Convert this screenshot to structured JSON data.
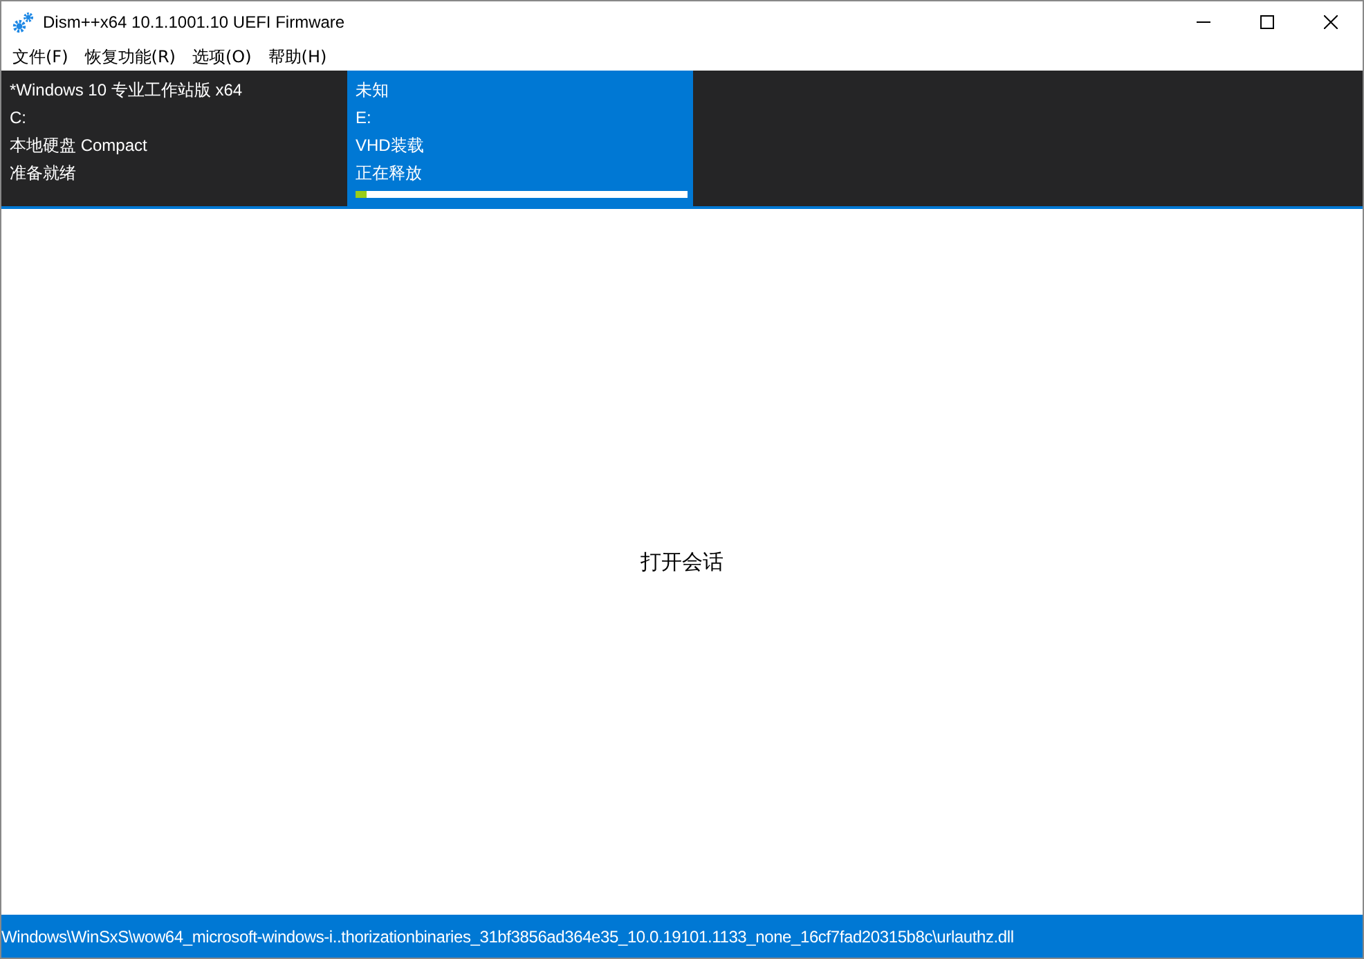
{
  "window": {
    "title": "Dism++x64 10.1.1001.10 UEFI Firmware"
  },
  "menu": [
    "文件(F)",
    "恢复功能(R)",
    "选项(O)",
    "帮助(H)"
  ],
  "sessions": [
    {
      "selected": false,
      "lines": [
        "*Windows 10 专业工作站版 x64",
        "C:",
        "本地硬盘 Compact",
        "准备就绪"
      ]
    },
    {
      "selected": true,
      "lines": [
        "未知",
        "E:",
        "VHD装载",
        "正在释放"
      ],
      "level": 0.035
    }
  ],
  "main": {
    "message": "打开会话"
  },
  "status_bar": "Windows\\WinSxS\\wow64_microsoft-windows-i..thorizationbinaries_31bf3856ad364e35_10.0.19101.1133_none_16cf7fad20315b8c\\urlauthz.dll"
}
